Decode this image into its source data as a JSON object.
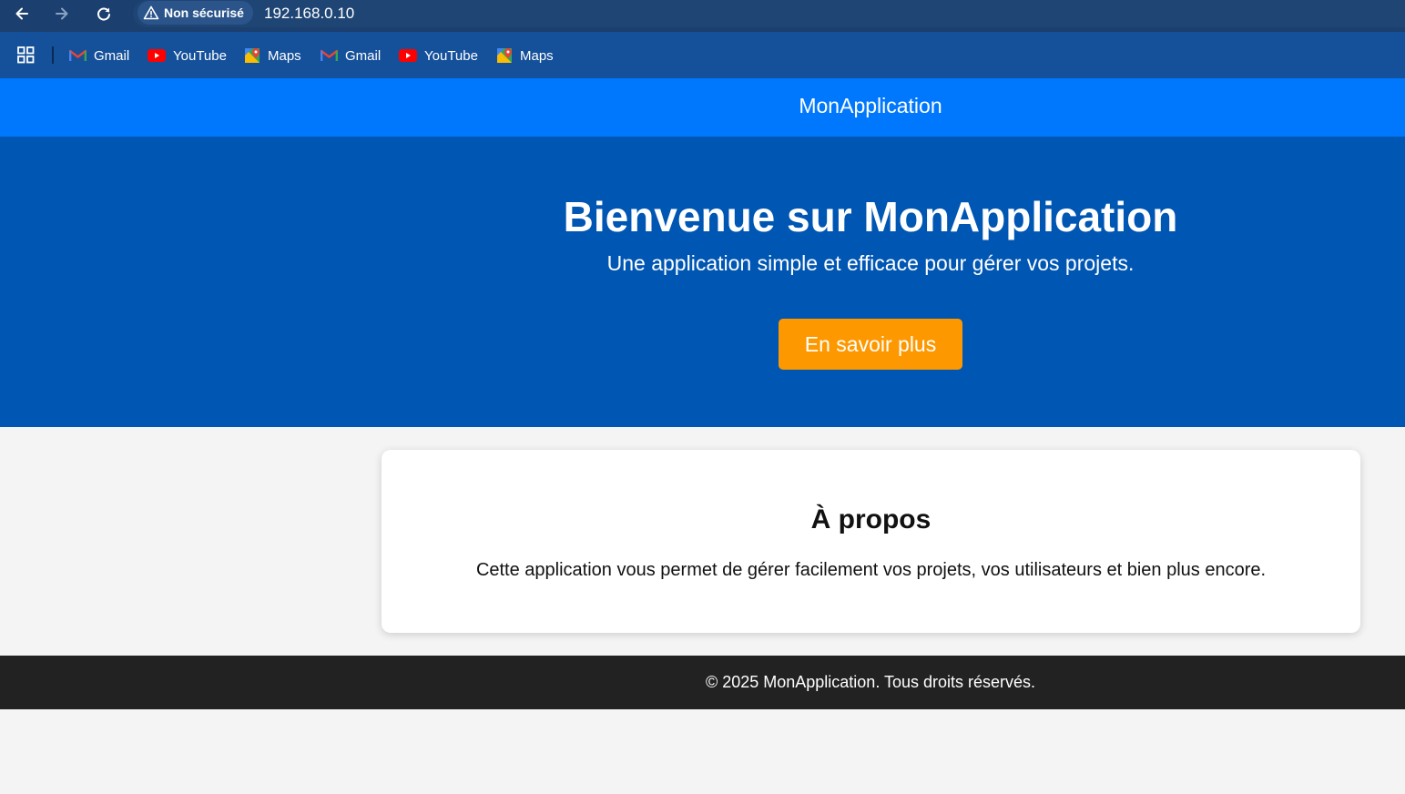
{
  "browser": {
    "security_label": "Non sécurisé",
    "url": "192.168.0.10",
    "nav": {
      "back_icon": "arrow-left-icon",
      "forward_icon": "arrow-right-icon",
      "reload_icon": "reload-icon"
    },
    "bookmarks": [
      {
        "label": "Gmail",
        "icon": "gmail-icon"
      },
      {
        "label": "YouTube",
        "icon": "youtube-icon"
      },
      {
        "label": "Maps",
        "icon": "maps-icon"
      },
      {
        "label": "Gmail",
        "icon": "gmail-icon"
      },
      {
        "label": "YouTube",
        "icon": "youtube-icon"
      },
      {
        "label": "Maps",
        "icon": "maps-icon"
      }
    ]
  },
  "header": {
    "logo": "MonApplication"
  },
  "hero": {
    "title": "Bienvenue sur MonApplication",
    "subtitle": "Une application simple et efficace pour gérer vos projets.",
    "cta_label": "En savoir plus"
  },
  "about": {
    "title": "À propos",
    "text": "Cette application vous permet de gérer facilement vos projets, vos utilisateurs et bien plus encore."
  },
  "footer": {
    "text": "© 2025 MonApplication. Tous droits réservés."
  },
  "colors": {
    "toolbar": "#1b3f6e",
    "bookmarks_bar": "#15509a",
    "header": "#0078fe",
    "hero": "#0056b3",
    "cta": "#fe9800",
    "page_bg": "#f4f4f4",
    "footer": "#222222"
  }
}
